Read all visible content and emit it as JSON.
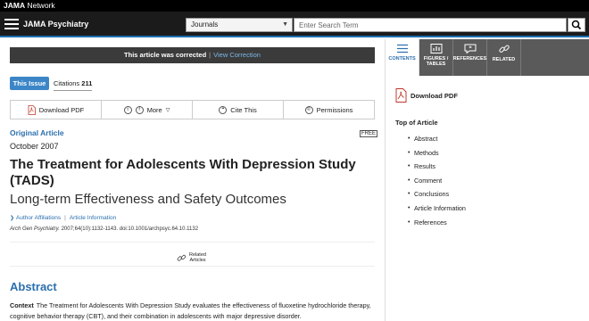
{
  "network": {
    "brand_bold": "JAMA",
    "brand_rest": " Network"
  },
  "header": {
    "journal": "JAMA Psychiatry",
    "select_value": "Journals",
    "search_placeholder": "Enter Search Term"
  },
  "correction": {
    "text": "This article was corrected",
    "sep": "|",
    "link": "View Correction"
  },
  "issue": {
    "this_issue": "This Issue",
    "citations_label": "Citations",
    "citations_count": "211"
  },
  "toolbar": {
    "download_pdf": "Download PDF",
    "more": "More",
    "cite_this": "Cite This",
    "permissions": "Permissions"
  },
  "article": {
    "type": "Original Article",
    "free": "FREE",
    "date": "October 2007",
    "title": "The Treatment for Adolescents With Depression Study (TADS)",
    "subtitle": "Long-term Effectiveness and Safety Outcomes",
    "author_affiliations": "Author Affiliations",
    "article_information": "Article Information",
    "citation_journal": "Arch Gen Psychiatry.",
    "citation_rest": " 2007;64(10):1132-1143. doi:10.1001/archpsyc.64.10.1132",
    "related_line1": "Related",
    "related_line2": "Articles"
  },
  "abstract": {
    "heading": "Abstract",
    "context_label": "Context",
    "context_text": "The Treatment for Adolescents With Depression Study evaluates the effectiveness of fluoxetine hydrochloride therapy, cognitive behavior therapy (CBT), and their combination in adolescents with major depressive disorder."
  },
  "right_panel": {
    "tabs": [
      {
        "label1": "CONTENTS",
        "label2": ""
      },
      {
        "label1": "FIGURES /",
        "label2": "TABLES"
      },
      {
        "label1": "REFERENCES",
        "label2": ""
      },
      {
        "label1": "RELATED",
        "label2": ""
      }
    ],
    "download_pdf": "Download PDF",
    "top_of_article": "Top of Article",
    "toc": [
      "Abstract",
      "Methods",
      "Results",
      "Comment",
      "Conclusions",
      "Article Information",
      "References"
    ]
  },
  "colors": {
    "accent": "#2a6fae",
    "header_bg": "#1b1b1b",
    "correction_bg": "#3b3b3b",
    "tab_bg": "#5a5a5a"
  }
}
